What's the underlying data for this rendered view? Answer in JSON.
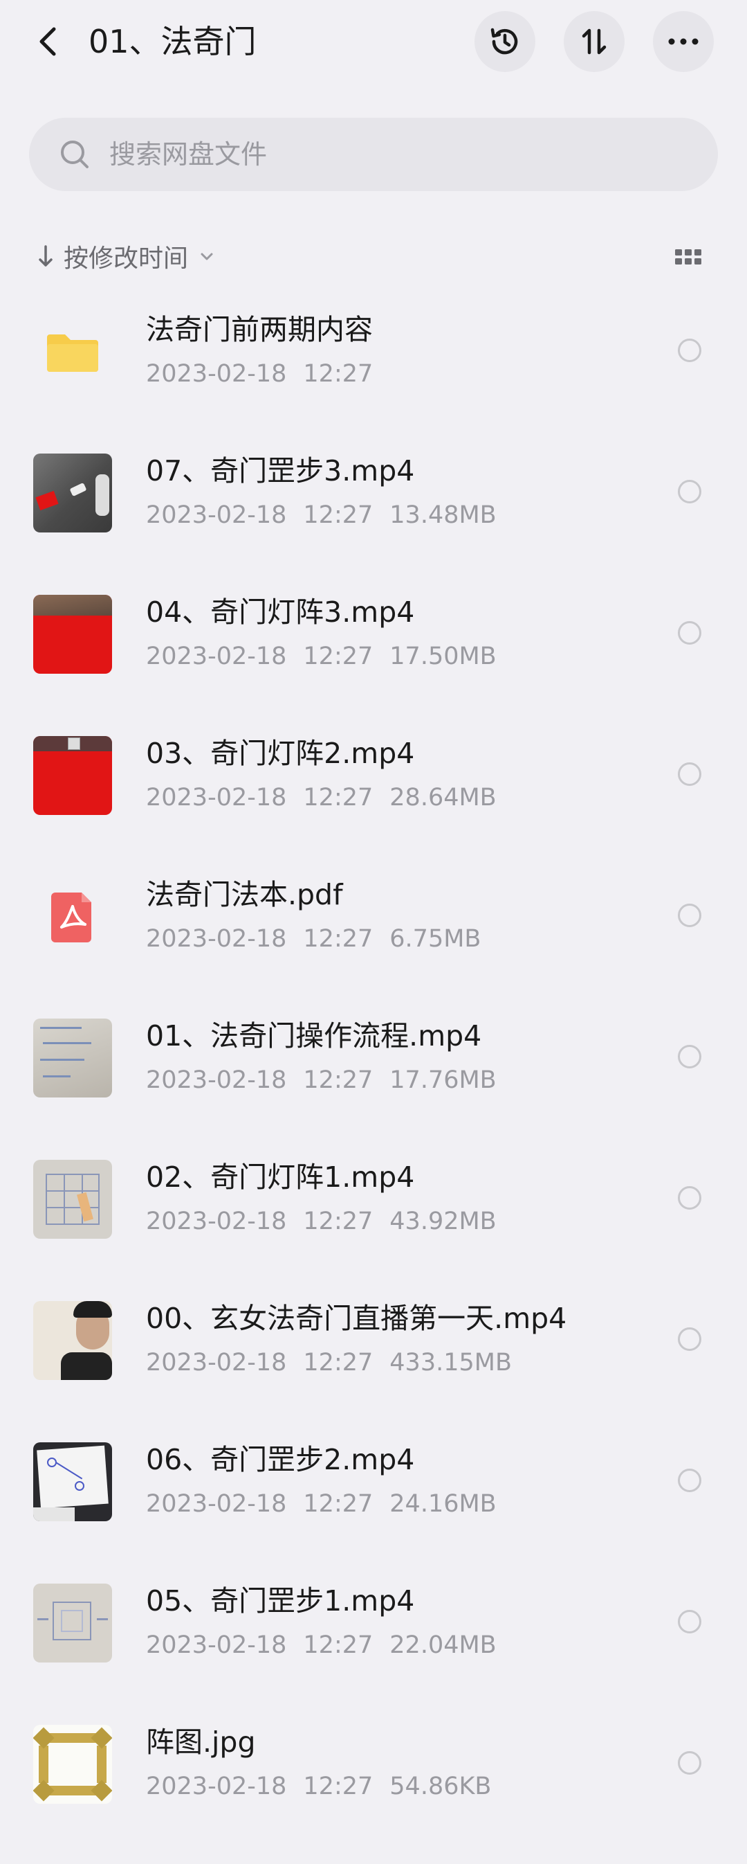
{
  "header": {
    "title": "01、法奇门"
  },
  "search": {
    "placeholder": "搜索网盘文件"
  },
  "sort": {
    "label": "按修改时间"
  },
  "files": [
    {
      "name": "法奇门前两期内容",
      "date": "2023-02-18",
      "time": "12:27",
      "size": "",
      "kind": "folder"
    },
    {
      "name": "07、奇门罡步3.mp4",
      "date": "2023-02-18",
      "time": "12:27",
      "size": "13.48MB",
      "kind": "video-dark"
    },
    {
      "name": "04、奇门灯阵3.mp4",
      "date": "2023-02-18",
      "time": "12:27",
      "size": "17.50MB",
      "kind": "video-red"
    },
    {
      "name": "03、奇门灯阵2.mp4",
      "date": "2023-02-18",
      "time": "12:27",
      "size": "28.64MB",
      "kind": "video-red2"
    },
    {
      "name": "法奇门法本.pdf",
      "date": "2023-02-18",
      "time": "12:27",
      "size": "6.75MB",
      "kind": "pdf"
    },
    {
      "name": "01、法奇门操作流程.mp4",
      "date": "2023-02-18",
      "time": "12:27",
      "size": "17.76MB",
      "kind": "video-paper"
    },
    {
      "name": "02、奇门灯阵1.mp4",
      "date": "2023-02-18",
      "time": "12:27",
      "size": "43.92MB",
      "kind": "video-grid"
    },
    {
      "name": "00、玄女法奇门直播第一天.mp4",
      "date": "2023-02-18",
      "time": "12:27",
      "size": "433.15MB",
      "kind": "video-person"
    },
    {
      "name": "06、奇门罡步2.mp4",
      "date": "2023-02-18",
      "time": "12:27",
      "size": "24.16MB",
      "kind": "video-diagram"
    },
    {
      "name": "05、奇门罡步1.mp4",
      "date": "2023-02-18",
      "time": "12:27",
      "size": "22.04MB",
      "kind": "video-paper2"
    },
    {
      "name": "阵图.jpg",
      "date": "2023-02-18",
      "time": "12:27",
      "size": "54.86KB",
      "kind": "image"
    }
  ],
  "colors": {
    "background": "#f1f0f4",
    "folder": "#f7cc4a",
    "pdf": "#ef6262",
    "video_red": "#e11515"
  }
}
